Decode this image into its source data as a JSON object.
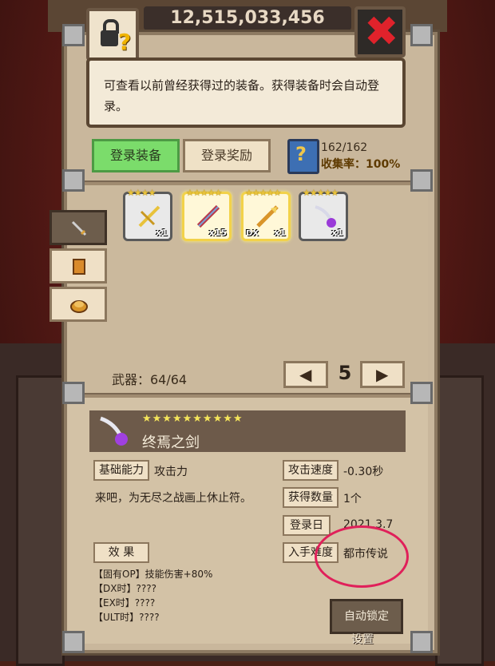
{
  "top": {
    "currency_value": "12,515,033,456"
  },
  "info": {
    "description": "可查看以前曾经获得过的装备。获得装备时会自动登录。"
  },
  "tabs": {
    "register_equipment": "登录装备",
    "register_reward": "登录奖励"
  },
  "collection": {
    "count": "162/162",
    "rate": "收集率：100%"
  },
  "side_tabs": [
    "weapon-icon",
    "armor-icon",
    "accessory-icon"
  ],
  "items": [
    {
      "icon": "gold-crossbow-icon",
      "stars": "★★★★",
      "qty": "x1",
      "dx": ""
    },
    {
      "icon": "red-sword-icon",
      "stars": "★★★★★",
      "qty": "x15",
      "dx": ""
    },
    {
      "icon": "gold-spear-icon",
      "stars": "★★★★★",
      "qty": "x1",
      "dx": "DX"
    },
    {
      "icon": "purple-mace-icon",
      "stars": "★★★★★",
      "qty": "x1",
      "dx": ""
    }
  ],
  "weapon_count": "武器：64/64",
  "pager": {
    "page": "5"
  },
  "detail": {
    "stars": "★★★★★★★★★★",
    "name": "终焉之剑",
    "basic_label": "基础能力",
    "basic_value": "攻击力",
    "flavor": "来吧，为无尽之战画上休止符。",
    "speed_label": "攻击速度",
    "speed_value": "-0.30秒",
    "obtained_label": "获得数量",
    "obtained_value": "1个",
    "date_label": "登录日",
    "date_value": "2021.3.7",
    "difficulty_label": "入手难度",
    "difficulty_value": "都市传说",
    "effect_label": "效 果",
    "effects": [
      "【固有OP】技能伤害+80%",
      "【DX时】????",
      "【EX时】????",
      "【ULT时】????"
    ],
    "autolock": "自动锁定",
    "settings": "设置"
  },
  "colors": {
    "tab_active": "#7bdc6b",
    "annotation": "#e0205a"
  }
}
